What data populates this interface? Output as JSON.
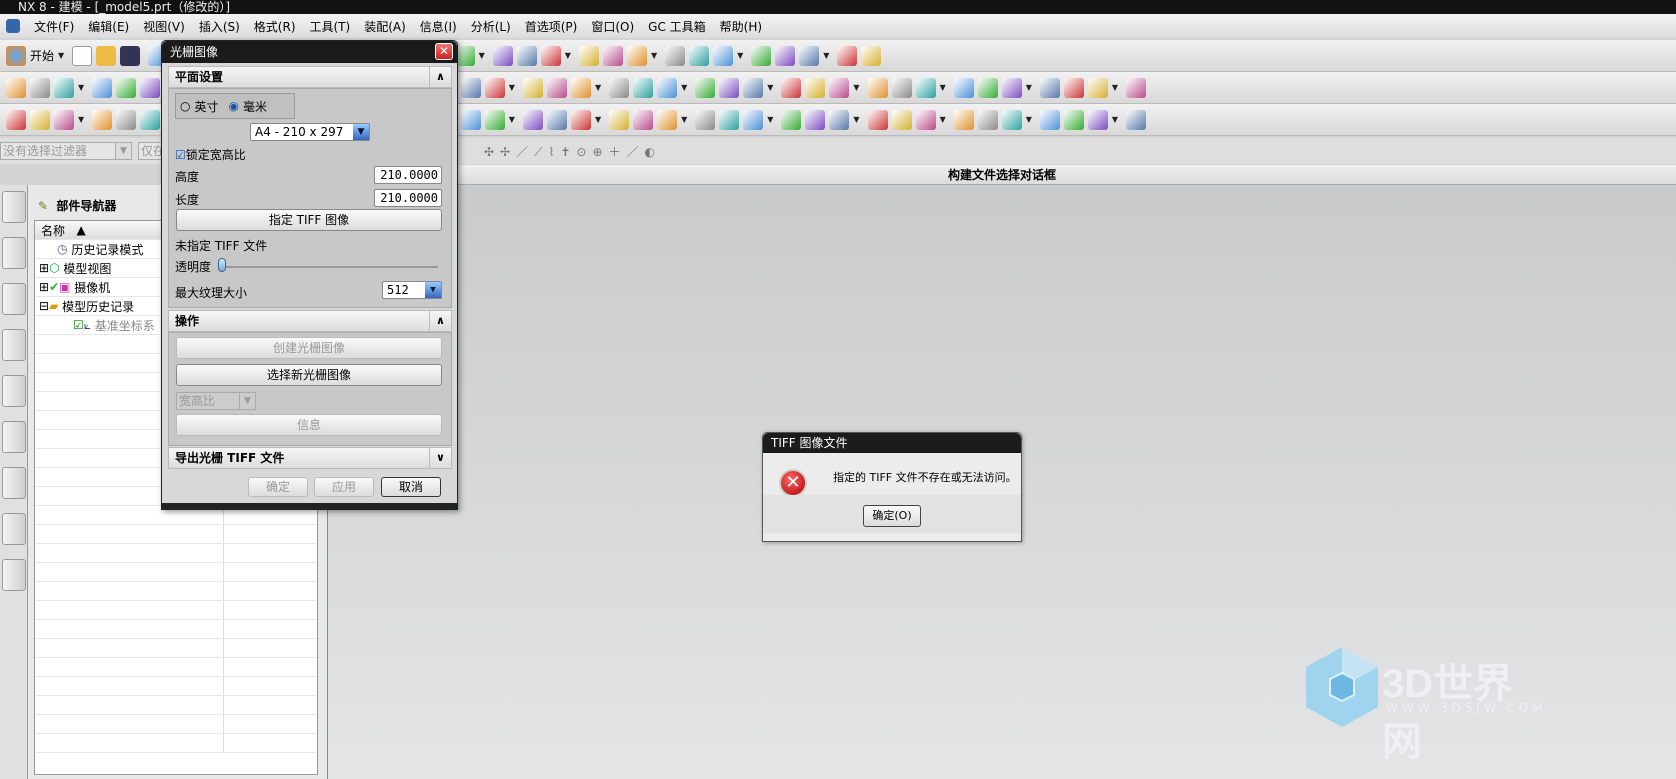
{
  "window": {
    "title": "NX 8 - 建模 - [_model5.prt（修改的）]"
  },
  "menu": [
    "文件(F)",
    "编辑(E)",
    "视图(V)",
    "插入(S)",
    "格式(R)",
    "工具(T)",
    "装配(A)",
    "信息(I)",
    "分析(L)",
    "首选项(P)",
    "窗口(O)",
    "GC 工具箱",
    "帮助(H)"
  ],
  "toolbar": {
    "start_label": "开始"
  },
  "filter": {
    "selection_filter": "没有选择过滤器",
    "scope": "仅在"
  },
  "graphics": {
    "header": "构建文件选择对话框"
  },
  "navigator": {
    "title": "部件导航器",
    "column": "名称",
    "items": [
      {
        "label": "历史记录模式"
      },
      {
        "label": "模型视图"
      },
      {
        "label": "摄像机"
      },
      {
        "label": "模型历史记录"
      },
      {
        "label": "基准坐标系"
      }
    ]
  },
  "raster_dialog": {
    "title": "光栅图像",
    "section_plane": "平面设置",
    "unit_inch": "英寸",
    "unit_mm": "毫米",
    "selected_unit": "毫米",
    "paper_size": "A4 - 210 x 297",
    "lock_aspect": "锁定宽高比",
    "lock_aspect_checked": true,
    "height_label": "高度",
    "height_value": "210.0000",
    "length_label": "长度",
    "length_value": "210.0000",
    "specify_tiff": "指定 TIFF 图像",
    "no_tiff": "未指定 TIFF 文件",
    "transparency_label": "透明度",
    "transparency": 0,
    "max_texture_label": "最大纹理大小",
    "max_texture": "512",
    "section_ops": "操作",
    "create_btn": "创建光栅图像",
    "select_btn": "选择新光栅图像",
    "aspect_combo": "宽高比",
    "info_btn": "信息",
    "section_export": "导出光栅 TIFF 文件",
    "ok": "确定",
    "apply": "应用",
    "cancel": "取消"
  },
  "message": {
    "title": "TIFF 图像文件",
    "text": "指定的 TIFF 文件不存在或无法访问。",
    "ok": "确定(O)"
  },
  "watermark": {
    "name": "3D世界网",
    "url": "WWW.3DSJW.COM"
  }
}
